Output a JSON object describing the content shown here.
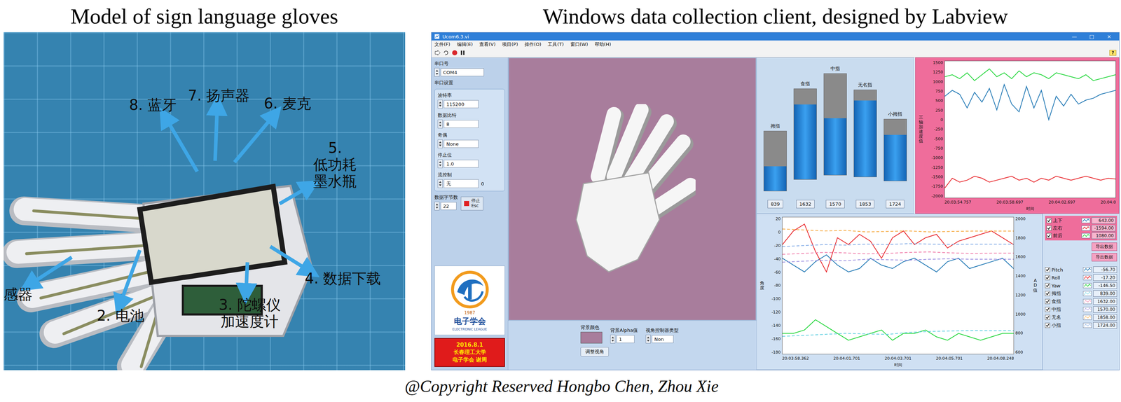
{
  "headings": {
    "left": "Model of sign language gloves",
    "right": "Windows data collection client, designed by Labview"
  },
  "photo": {
    "annotations": [
      {
        "lines": [
          "8. 蓝牙"
        ]
      },
      {
        "lines": [
          "7. 扬声器"
        ]
      },
      {
        "lines": [
          "6. 麦克"
        ]
      },
      {
        "lines": [
          "5.",
          "低功耗",
          "墨水瓶"
        ]
      },
      {
        "lines": [
          "4. 数据下载"
        ]
      },
      {
        "lines": [
          "3. 陀螺仪",
          "加速度计"
        ]
      },
      {
        "lines": [
          "2. 电池"
        ]
      },
      {
        "lines": [
          "感器"
        ]
      }
    ]
  },
  "window": {
    "title": "Ucom6.3.vi",
    "controls": [
      "—",
      "□",
      "×"
    ],
    "menu": [
      "文件(F)",
      "编辑(E)",
      "查看(V)",
      "项目(P)",
      "操作(O)",
      "工具(T)",
      "窗口(W)",
      "帮助(H)"
    ],
    "help": "?"
  },
  "serial": {
    "port_label": "串口号",
    "port": "COM4",
    "group_title": "串口设置",
    "fields": [
      {
        "label": "波特率",
        "value": "115200"
      },
      {
        "label": "数据比特",
        "value": "8"
      },
      {
        "label": "奇偶",
        "value": "None"
      },
      {
        "label": "停止位",
        "value": "1.0"
      },
      {
        "label": "流控制",
        "value": "无"
      }
    ],
    "flow_extra": "0",
    "bytes_label": "数据字节数",
    "bytes": "22",
    "stop": {
      "label": "停止",
      "key": "Esc"
    }
  },
  "logo": {
    "year": "1987",
    "name": "电子学会",
    "sub": "ELECTRONIC LEAGUE"
  },
  "banner": [
    "2016.8.1",
    "长春理工大学",
    "电子学会 谢周"
  ],
  "view": {
    "bg_label": "背景颜色",
    "alpha_label": "背景Alpha值",
    "alpha": "1",
    "camera_label": "视角控制器类型",
    "camera": "Non",
    "reset": "调整视角"
  },
  "fingers": [
    {
      "name": "拇指",
      "reading": "839",
      "level": 0.41
    },
    {
      "name": "食指",
      "reading": "1632",
      "level": 0.83
    },
    {
      "name": "中指",
      "reading": "1570",
      "level": 0.56
    },
    {
      "name": "无名指",
      "reading": "1853",
      "level": 0.88
    },
    {
      "name": "小拇指",
      "reading": "1724",
      "level": 0.75
    }
  ],
  "accel_chart": {
    "y_label": "三轴加速度值",
    "x_label": "时间",
    "min": -2000,
    "max": 1500,
    "y_ticks": [
      "1500",
      "1250",
      "1000",
      "750",
      "500",
      "250",
      "0",
      "-250",
      "-500",
      "-750",
      "-1000",
      "-1250",
      "-1500",
      "-1750",
      "-2000"
    ],
    "x_ticks": [
      "20:03:54.757",
      "20:03:58.697",
      "20:04:02.697",
      "20:04:0"
    ],
    "series": [
      {
        "name": "上下",
        "reading": "643.00",
        "checked": true,
        "color": "#1f77b4",
        "values": [
          600,
          750,
          650,
          300,
          700,
          450,
          800,
          250,
          900,
          400,
          200,
          850,
          300,
          750,
          0,
          600,
          350,
          650,
          400,
          500,
          550,
          650,
          700,
          750
        ]
      },
      {
        "name": "左右",
        "reading": "-1594.00",
        "checked": true,
        "color": "#e8262b",
        "values": [
          -1750,
          -1500,
          -1600,
          -1550,
          -1450,
          -1500,
          -1600,
          -1550,
          -1500,
          -1450,
          -1550,
          -1500,
          -1600,
          -1500,
          -1550,
          -1450,
          -1500,
          -1550,
          -1500,
          -1450,
          -1500,
          -1550,
          -1500,
          -1520
        ]
      },
      {
        "name": "前后",
        "reading": "1080.00",
        "checked": true,
        "color": "#22d63a",
        "values": [
          1100,
          1150,
          1050,
          1200,
          1000,
          1150,
          1300,
          1100,
          1200,
          1050,
          1250,
          1100,
          1200,
          1150,
          1050,
          1200,
          1150,
          1100,
          1050,
          1150,
          1000,
          1050,
          1100,
          1150
        ]
      }
    ]
  },
  "export_buttons": [
    "导出数据",
    "导出数据"
  ],
  "angle_chart": {
    "left_label": "角度",
    "right_label": "AD值",
    "x_label": "时间",
    "left_min": -180,
    "left_max": 20,
    "right_min": 600,
    "right_max": 2000,
    "left_ticks": [
      "20",
      "0",
      "-20",
      "-40",
      "-60",
      "-80",
      "-100",
      "-120",
      "-140",
      "-160",
      "-180"
    ],
    "right_ticks": [
      "2000",
      "1800",
      "1600",
      "1400",
      "1200",
      "1000",
      "800",
      "600"
    ],
    "x_ticks": [
      "20:03:58.362",
      "20:04:01.701",
      "20:04:03.701",
      "20:04:05.701",
      "20:04:08.248"
    ],
    "series": [
      {
        "name": "Pitch",
        "reading": "-56.70",
        "checked": true,
        "axis": "left",
        "kind": "solid",
        "color": "#1f77b4",
        "values": [
          -40,
          -50,
          -60,
          -45,
          -35,
          -50,
          -60,
          -55,
          -40,
          -50,
          -55,
          -45,
          -40,
          -50,
          -60,
          -45,
          -40,
          -55,
          -50,
          -45,
          -40,
          -55
        ]
      },
      {
        "name": "Roll",
        "reading": "-17.20",
        "checked": true,
        "axis": "left",
        "kind": "solid",
        "color": "#e8262b",
        "values": [
          -20,
          0,
          10,
          -30,
          -60,
          -10,
          -20,
          -5,
          -15,
          -40,
          -10,
          0,
          -20,
          -10,
          -5,
          -25,
          -15,
          -10,
          -5,
          0,
          -10,
          -20
        ]
      },
      {
        "name": "Yaw",
        "reading": "-146.50",
        "checked": true,
        "axis": "left",
        "kind": "solid",
        "color": "#22d63a",
        "values": [
          -150,
          -150,
          -145,
          -130,
          -140,
          -150,
          -160,
          -155,
          -150,
          -145,
          -160,
          -150,
          -150,
          -145,
          -155,
          -160,
          -150,
          -155,
          -160,
          -155,
          -150,
          -150
        ]
      },
      {
        "name": "拇指",
        "reading": "839.00",
        "checked": true,
        "axis": "right",
        "kind": "dashed",
        "color": "#5fcfe0",
        "values": [
          780,
          790,
          800,
          810,
          805,
          800,
          820,
          830,
          835,
          840,
          838,
          839
        ]
      },
      {
        "name": "食指",
        "reading": "1632.00",
        "checked": true,
        "axis": "right",
        "kind": "dashed",
        "color": "#f07aa8",
        "values": [
          1620,
          1630,
          1640,
          1635,
          1625,
          1630,
          1640,
          1645,
          1635,
          1630,
          1632,
          1632
        ]
      },
      {
        "name": "中指",
        "reading": "1570.00",
        "checked": true,
        "axis": "right",
        "kind": "dashed",
        "color": "#9b8fe0",
        "values": [
          1540,
          1550,
          1560,
          1555,
          1570,
          1565,
          1560,
          1570,
          1575,
          1570,
          1570,
          1570
        ]
      },
      {
        "name": "无名",
        "reading": "1858.00",
        "checked": true,
        "axis": "right",
        "kind": "dashed",
        "color": "#f6a83d",
        "values": [
          1880,
          1870,
          1860,
          1865,
          1850,
          1855,
          1860,
          1850,
          1855,
          1858,
          1858,
          1858
        ]
      },
      {
        "name": "小指",
        "reading": "1724.00",
        "checked": true,
        "axis": "right",
        "kind": "dashed",
        "color": "#7fa9e6",
        "values": [
          1700,
          1710,
          1720,
          1715,
          1725,
          1720,
          1730,
          1725,
          1722,
          1724,
          1724,
          1724
        ]
      }
    ]
  },
  "caption": "@Copyright Reserved Hongbo Chen, Zhou Xie"
}
